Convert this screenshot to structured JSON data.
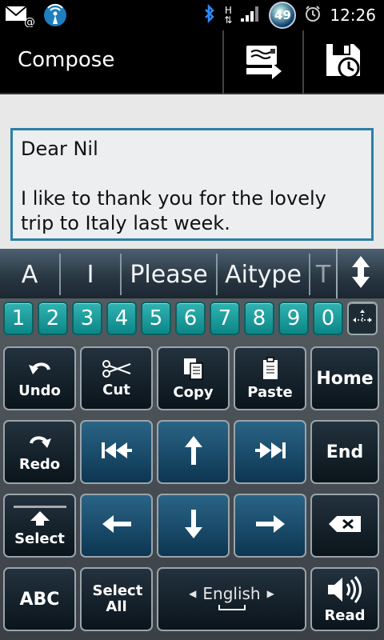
{
  "status": {
    "clock": "12:26",
    "battery": "49",
    "network_label": "H"
  },
  "header": {
    "title": "Compose"
  },
  "compose": {
    "body": "Dear Nil\n\nI like to thank you for the lovely trip to Italy last week."
  },
  "suggestions": [
    "A",
    "I",
    "Please",
    "Aitype",
    "T"
  ],
  "numbers": [
    "1",
    "2",
    "3",
    "4",
    "5",
    "6",
    "7",
    "8",
    "9",
    "0"
  ],
  "keys": {
    "undo": "Undo",
    "cut": "Cut",
    "copy": "Copy",
    "paste": "Paste",
    "home": "Home",
    "redo": "Redo",
    "end": "End",
    "select": "Select",
    "abc": "ABC",
    "select_all": "Select All",
    "language": "English",
    "read": "Read"
  }
}
